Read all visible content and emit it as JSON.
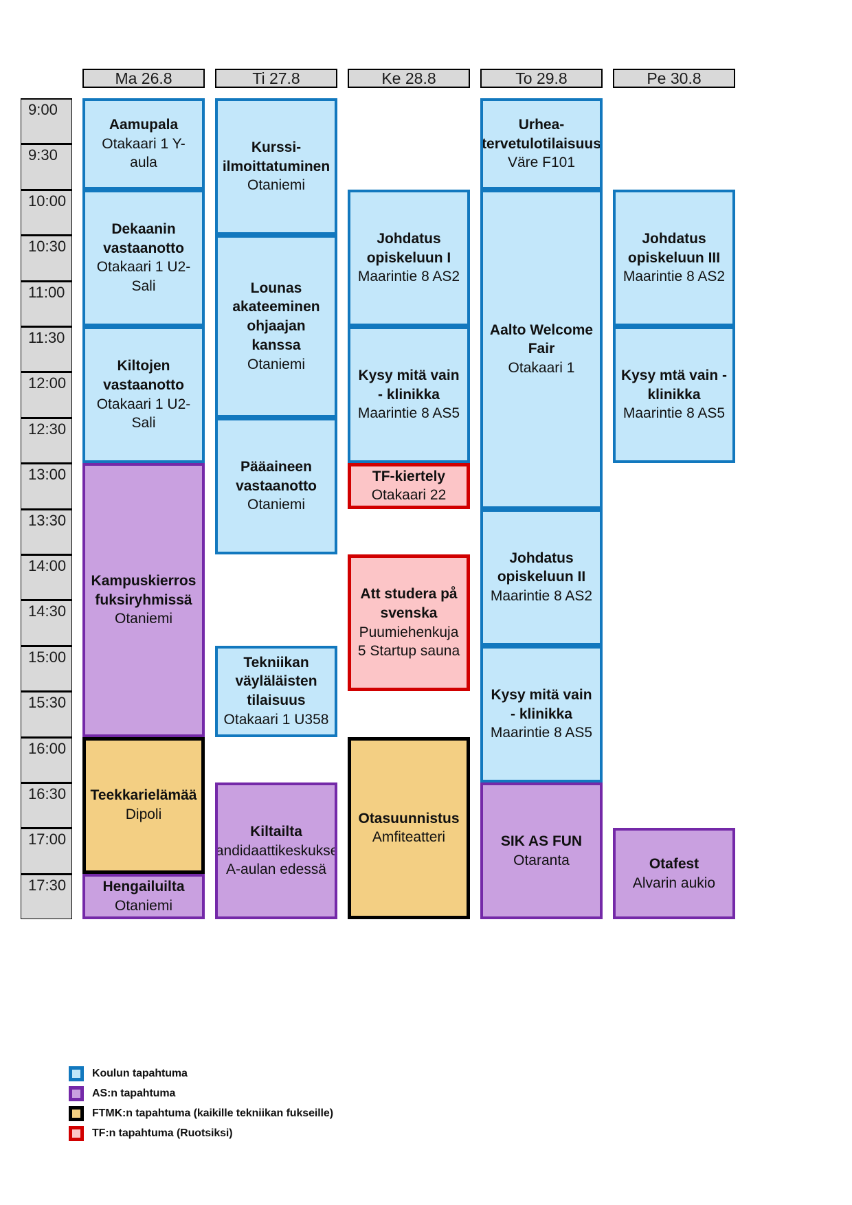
{
  "schedule": {
    "days": [
      {
        "label": "Ma 26.8"
      },
      {
        "label": "Ti 27.8"
      },
      {
        "label": "Ke 28.8"
      },
      {
        "label": "To 29.8"
      },
      {
        "label": "Pe 30.8"
      }
    ],
    "times": [
      "9:00",
      "9:30",
      "10:00",
      "10:30",
      "11:00",
      "11:30",
      "12:00",
      "12:30",
      "13:00",
      "13:30",
      "14:00",
      "14:30",
      "15:00",
      "15:30",
      "16:00",
      "16:30",
      "17:00",
      "17:30"
    ],
    "events": [
      {
        "day": 0,
        "start": "9:00",
        "end": "10:00",
        "title": "Aamupala",
        "location": "Otakaari 1 Y-aula",
        "category": "school"
      },
      {
        "day": 0,
        "start": "10:00",
        "end": "11:30",
        "title": "Dekaanin vastaanotto",
        "location": "Otakaari 1 U2-Sali",
        "category": "school"
      },
      {
        "day": 0,
        "start": "11:30",
        "end": "13:00",
        "title": "Kiltojen vastaanotto",
        "location": "Otakaari 1 U2-Sali",
        "category": "school"
      },
      {
        "day": 0,
        "start": "13:00",
        "end": "16:00",
        "title": "Kampuskierros fuksiryhmissä",
        "location": "Otaniemi",
        "category": "as"
      },
      {
        "day": 0,
        "start": "16:00",
        "end": "17:30",
        "title": "Teekkarielämää",
        "location": "Dipoli",
        "category": "ftmk"
      },
      {
        "day": 0,
        "start": "17:30",
        "end": "18:00",
        "title": "Hengailuilta",
        "location": "Otaniemi",
        "category": "as"
      },
      {
        "day": 1,
        "start": "9:00",
        "end": "10:30",
        "title": "Kurssi-ilmoittatuminen",
        "location": "Otaniemi",
        "category": "school"
      },
      {
        "day": 1,
        "start": "10:30",
        "end": "12:30",
        "title": "Lounas akateeminen ohjaajan kanssa",
        "location": "Otaniemi",
        "category": "school"
      },
      {
        "day": 1,
        "start": "12:30",
        "end": "14:00",
        "title": "Pääaineen vastaanotto",
        "location": "Otaniemi",
        "category": "school"
      },
      {
        "day": 1,
        "start": "15:00",
        "end": "16:00",
        "title": "Tekniikan väyläläisten tilaisuus",
        "location": "Otakaari 1 U358",
        "category": "school"
      },
      {
        "day": 1,
        "start": "16:30",
        "end": "18:00",
        "title": "Kiltailta",
        "location": "Kandidaattikeskuksen A-aulan edessä",
        "category": "as"
      },
      {
        "day": 2,
        "start": "10:00",
        "end": "11:30",
        "title": "Johdatus opiskeluun I",
        "location": "Maarintie 8 AS2",
        "category": "school"
      },
      {
        "day": 2,
        "start": "11:30",
        "end": "13:00",
        "title": "Kysy mitä vain - klinikka",
        "location": "Maarintie 8 AS5",
        "category": "school"
      },
      {
        "day": 2,
        "start": "13:00",
        "end": "13:30",
        "title": "TF-kiertely",
        "location": "Otakaari 22",
        "category": "tf"
      },
      {
        "day": 2,
        "start": "14:00",
        "end": "15:30",
        "title": "Att studera på svenska",
        "location": "Puumiehenkuja 5 Startup sauna",
        "category": "tf"
      },
      {
        "day": 2,
        "start": "16:00",
        "end": "18:00",
        "title": "Otasuunnistus",
        "location": "Amfiteatteri",
        "category": "ftmk"
      },
      {
        "day": 3,
        "start": "9:00",
        "end": "10:00",
        "title": "Urhea-tervetulotilaisuus",
        "location": "Väre F101",
        "category": "school"
      },
      {
        "day": 3,
        "start": "10:00",
        "end": "13:30",
        "title": "Aalto Welcome Fair",
        "location": "Otakaari 1",
        "category": "school"
      },
      {
        "day": 3,
        "start": "13:30",
        "end": "15:00",
        "title": "Johdatus opiskeluun II",
        "location": "Maarintie 8 AS2",
        "category": "school"
      },
      {
        "day": 3,
        "start": "15:00",
        "end": "16:30",
        "title": "Kysy mitä vain - klinikka",
        "location": "Maarintie 8 AS5",
        "category": "school"
      },
      {
        "day": 3,
        "start": "16:30",
        "end": "18:00",
        "title": "SIK AS FUN",
        "location": "Otaranta",
        "category": "as"
      },
      {
        "day": 4,
        "start": "10:00",
        "end": "11:30",
        "title": "Johdatus opiskeluun III",
        "location": "Maarintie 8 AS2",
        "category": "school"
      },
      {
        "day": 4,
        "start": "11:30",
        "end": "13:00",
        "title": "Kysy mtä vain - klinikka",
        "location": "Maarintie 8 AS5",
        "category": "school"
      },
      {
        "day": 4,
        "start": "17:00",
        "end": "18:00",
        "title": "Otafest",
        "location": "Alvarin aukio",
        "category": "as"
      }
    ]
  },
  "legend": {
    "items": [
      {
        "label": "Koulun tapahtuma",
        "category": "school"
      },
      {
        "label": "AS:n tapahtuma",
        "category": "as"
      },
      {
        "label": "FTMK:n tapahtuma (kaikille tekniikan fukseille)",
        "category": "ftmk"
      },
      {
        "label": "TF:n tapahtuma (Ruotsiksi)",
        "category": "tf"
      }
    ]
  },
  "colors": {
    "school_fill": "#c3e7fa",
    "school_border": "#1278be",
    "as_fill": "#c9a0e0",
    "as_border": "#7429a8",
    "ftmk_fill": "#f3cf83",
    "ftmk_border": "#000000",
    "tf_fill": "#fcc5c7",
    "tf_border": "#d10000",
    "time_fill": "#d9d9d9",
    "header_fill": "#d9d9d9"
  }
}
